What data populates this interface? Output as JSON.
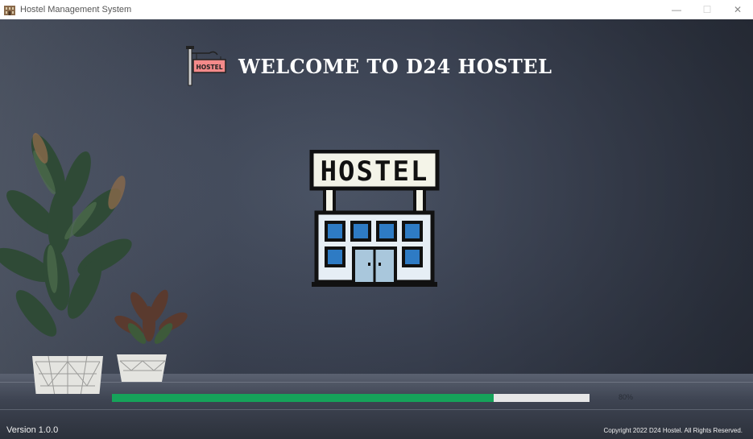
{
  "window": {
    "title": "Hostel Management System",
    "minimize_glyph": "—",
    "maximize_glyph": "☐",
    "close_glyph": "✕"
  },
  "header": {
    "sign_text": "HOSTEL",
    "welcome": "WELCOME TO D24 HOSTEL"
  },
  "logo": {
    "sign_text": "HOSTEL",
    "icon": "hostel-building-icon"
  },
  "progress": {
    "value": 0.8,
    "label": "80%",
    "fill_color": "#16a35a",
    "track_color": "#e6e6e6"
  },
  "footer": {
    "version": "Version 1.0.0",
    "copyright": "Copyright 2022 D24 Hostel. All Rights Reserved."
  }
}
